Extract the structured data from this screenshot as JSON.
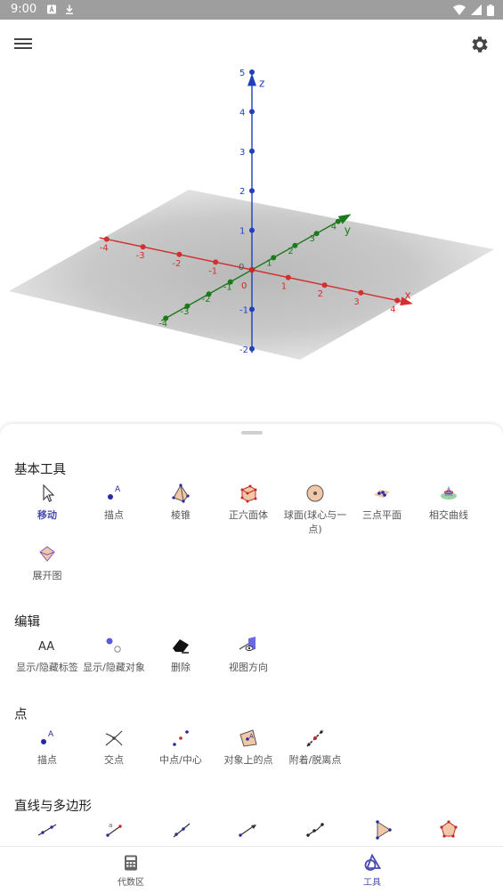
{
  "status_bar": {
    "time": "9:00"
  },
  "graphics_view": {
    "x_axis_label": "x",
    "y_axis_label": "y",
    "z_axis_label": "z",
    "origin_label": "0",
    "x_ticks": [
      "-4",
      "-3",
      "-2",
      "-1",
      "1",
      "2",
      "3",
      "4"
    ],
    "y_ticks": [
      "-4",
      "-3",
      "-2",
      "-1",
      "1",
      "2",
      "3",
      "4"
    ],
    "z_ticks": [
      "-2",
      "-1",
      "1",
      "2",
      "3",
      "4",
      "5"
    ],
    "colors": {
      "x_axis": "#d32f2f",
      "y_axis": "#1b7a1b",
      "z_axis": "#1f3fbf",
      "plane": "#bdbdbd"
    }
  },
  "toolbox": {
    "sections": [
      {
        "title": "基本工具",
        "tools": [
          {
            "label": "移动",
            "icon": "move-arrow-icon",
            "active": true
          },
          {
            "label": "描点",
            "icon": "point-icon"
          },
          {
            "label": "棱锥",
            "icon": "pyramid-icon"
          },
          {
            "label": "正六面体",
            "icon": "cube-icon"
          },
          {
            "label": "球面(球心与一点)",
            "icon": "sphere-icon"
          },
          {
            "label": "三点平面",
            "icon": "plane-three-points-icon"
          },
          {
            "label": "相交曲线",
            "icon": "intersect-curve-icon"
          },
          {
            "label": "展开图",
            "icon": "net-icon"
          }
        ]
      },
      {
        "title": "编辑",
        "tools": [
          {
            "label": "显示/隐藏标签",
            "icon": "label-icon"
          },
          {
            "label": "显示/隐藏对象",
            "icon": "show-hide-object-icon"
          },
          {
            "label": "删除",
            "icon": "eraser-icon"
          },
          {
            "label": "视图方向",
            "icon": "view-direction-icon"
          }
        ]
      },
      {
        "title": "点",
        "tools": [
          {
            "label": "描点",
            "icon": "point-icon"
          },
          {
            "label": "交点",
            "icon": "intersect-icon"
          },
          {
            "label": "中点/中心",
            "icon": "midpoint-icon"
          },
          {
            "label": "对象上的点",
            "icon": "point-on-object-icon"
          },
          {
            "label": "附着/脱离点",
            "icon": "attach-detach-icon"
          }
        ]
      },
      {
        "title": "直线与多边形",
        "tools": [
          {
            "label": "",
            "icon": "line-icon"
          },
          {
            "label": "",
            "icon": "segment-icon"
          },
          {
            "label": "",
            "icon": "ray-icon"
          },
          {
            "label": "",
            "icon": "vector-icon"
          },
          {
            "label": "",
            "icon": "polyline-icon"
          },
          {
            "label": "",
            "icon": "polygon-icon"
          },
          {
            "label": "",
            "icon": "regular-polygon-icon"
          }
        ]
      }
    ]
  },
  "bottom_nav": {
    "items": [
      {
        "label": "代数区",
        "icon": "calculator-icon"
      },
      {
        "label": "工具",
        "icon": "tools-icon",
        "active": true
      }
    ]
  }
}
